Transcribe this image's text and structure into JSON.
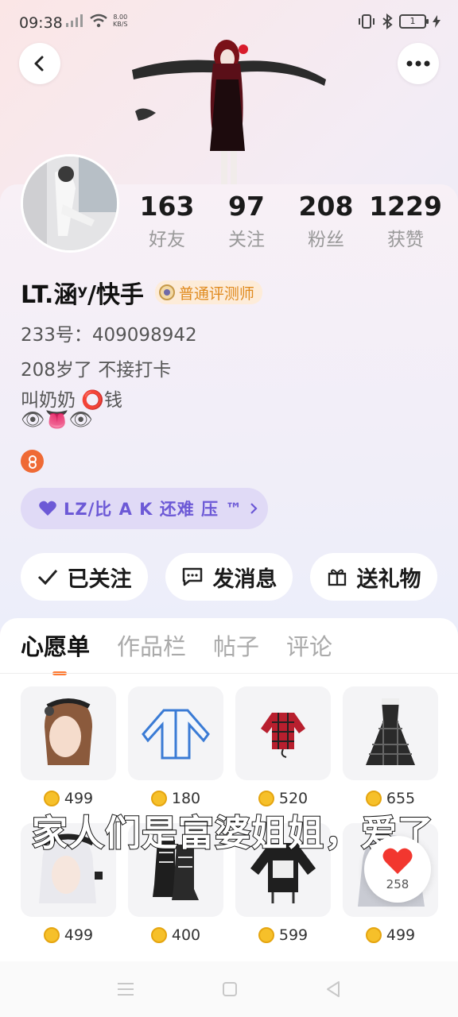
{
  "status_bar": {
    "time": "09:38",
    "net_speed_value": "8.00",
    "net_speed_unit": "KB/S",
    "battery": "1"
  },
  "profile": {
    "stats": [
      {
        "value": "163",
        "label": "好友"
      },
      {
        "value": "97",
        "label": "关注"
      },
      {
        "value": "208",
        "label": "粉丝"
      },
      {
        "value": "1229",
        "label": "获赞"
      }
    ],
    "username": "LT.涵ʸ/快手",
    "reviewer_badge": "普通评测师",
    "id_line": "233号：409098942",
    "bio_line_1": "208岁了 不接打卡",
    "bio_line_2": "叫奶奶 ⭕钱",
    "bio_emoji": "👁👅👁",
    "music_pill": "LZ/比 A K 还难 压 ™"
  },
  "actions": {
    "follow": "已关注",
    "message": "发消息",
    "gift": "送礼物"
  },
  "tabs": [
    "心愿单",
    "作品栏",
    "帖子",
    "评论"
  ],
  "wishlist": [
    {
      "icon": "maid-hair-icon",
      "price": "499"
    },
    {
      "icon": "jacket-icon",
      "price": "180"
    },
    {
      "icon": "red-plaid-top-icon",
      "price": "520"
    },
    {
      "icon": "plaid-dress-icon",
      "price": "655"
    },
    {
      "icon": "white-hair-icon",
      "price": "499"
    },
    {
      "icon": "black-boots-icon",
      "price": "400"
    },
    {
      "icon": "black-hoodie-icon",
      "price": "599"
    },
    {
      "icon": "silver-hair-icon",
      "price": "499"
    }
  ],
  "subtitle": "家人们是富婆姐姐，爱了",
  "like_count": "258",
  "colors": {
    "accent": "#ff7a32",
    "music_purple": "#6c59d6",
    "badge_orange": "#e08a1e",
    "coin": "#f6c02a"
  }
}
